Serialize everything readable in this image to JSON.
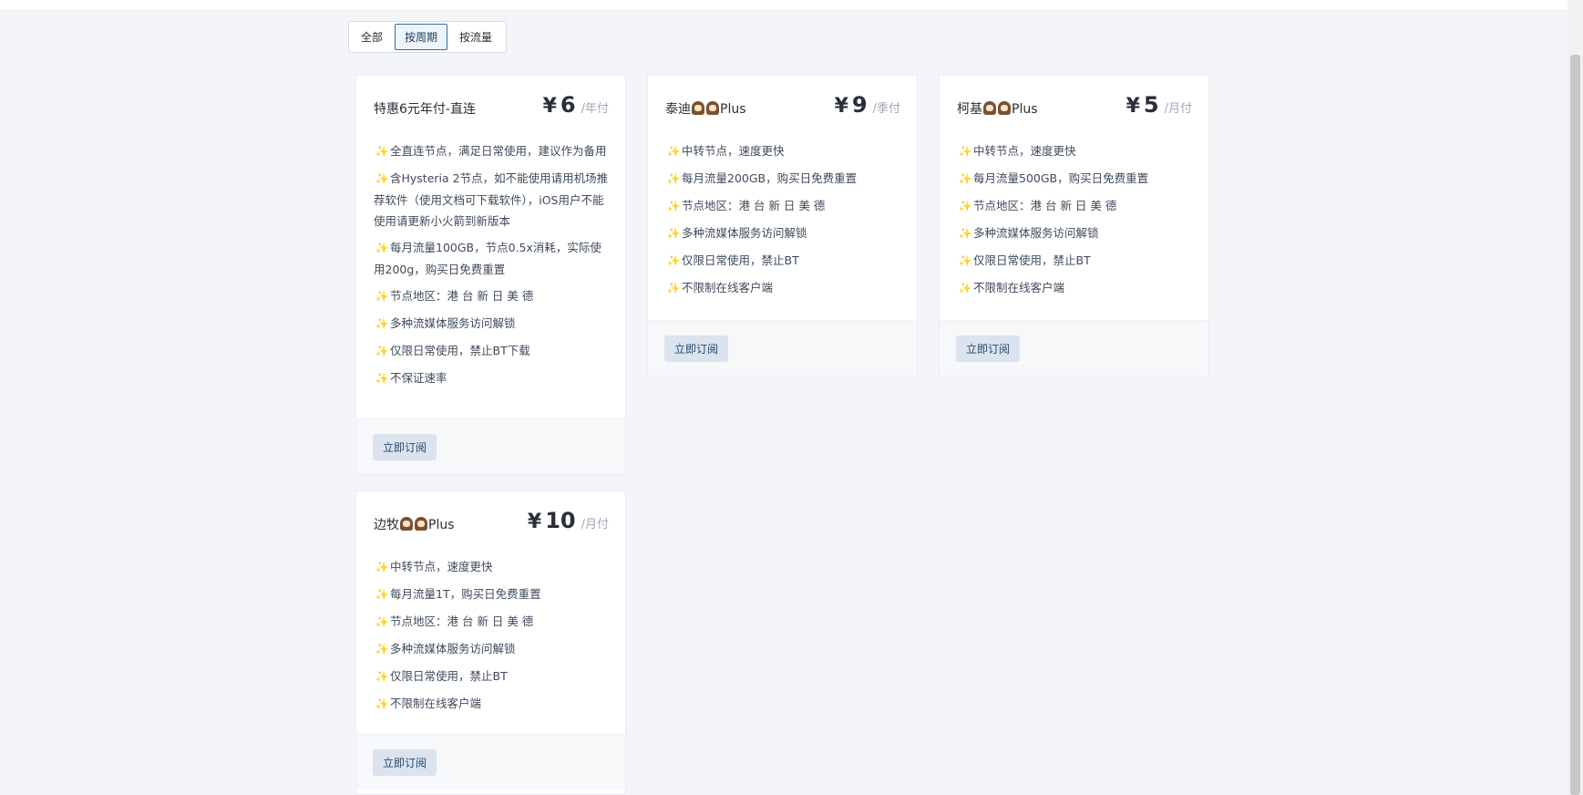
{
  "filters": [
    {
      "label": "全部",
      "active": false
    },
    {
      "label": "按周期",
      "active": true
    },
    {
      "label": "按流量",
      "active": false
    }
  ],
  "plans": [
    {
      "title": "特惠6元年付-直连",
      "currency": "¥",
      "price": "6",
      "period": "/年付",
      "features": [
        "全直连节点，满足日常使用，建议作为备用",
        "含Hysteria 2节点，如不能使用请用机场推荐软件（使用文档可下载软件），iOS用户不能使用请更新小火箭到新版本",
        "每月流量100GB，节点0.5x消耗，实际使用200g，购买日免费重置",
        "节点地区：港 台 新 日 美 德",
        "多种流媒体服务访问解锁",
        "仅限日常使用，禁止BT下载",
        "不保证速率"
      ],
      "button": "立即订阅"
    },
    {
      "title": "泰迪",
      "title_suffix": "Plus",
      "currency": "¥",
      "price": "9",
      "period": "/季付",
      "features": [
        "中转节点，速度更快",
        "每月流量200GB，购买日免费重置",
        "节点地区：港 台 新 日 美 德",
        "多种流媒体服务访问解锁",
        "仅限日常使用，禁止BT",
        "不限制在线客户端"
      ],
      "button": "立即订阅"
    },
    {
      "title": "柯基",
      "title_suffix": "Plus",
      "currency": "¥",
      "price": "5",
      "period": "/月付",
      "features": [
        "中转节点，速度更快",
        "每月流量500GB，购买日免费重置",
        "节点地区：港 台 新 日 美 德",
        "多种流媒体服务访问解锁",
        "仅限日常使用，禁止BT",
        "不限制在线客户端"
      ],
      "button": "立即订阅"
    },
    {
      "title": "边牧",
      "title_suffix": "Plus",
      "currency": "¥",
      "price": "10",
      "period": "/月付",
      "features": [
        "中转节点，速度更快",
        "每月流量1T，购买日免费重置",
        "节点地区：港 台 新 日 美 德",
        "多种流媒体服务访问解锁",
        "仅限日常使用，禁止BT",
        "不限制在线客户端"
      ],
      "button": "立即订阅"
    }
  ],
  "icons": {
    "feature": "sparkle-icon",
    "title_badge": "dog-face-icon"
  }
}
